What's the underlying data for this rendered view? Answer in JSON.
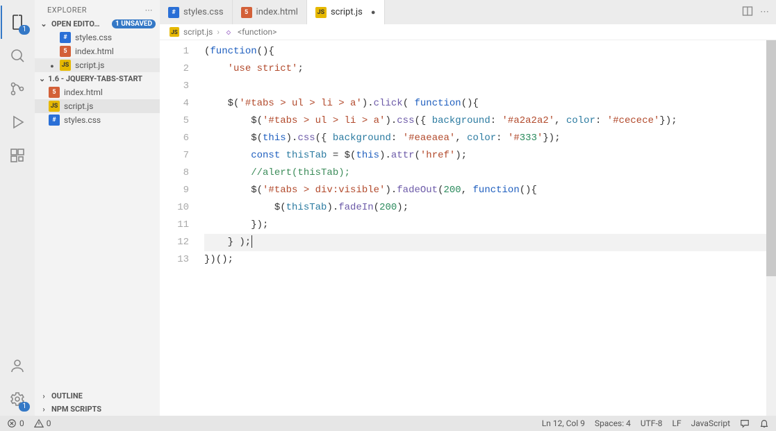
{
  "activity": {
    "explorer_badge": "1",
    "settings_badge": "1"
  },
  "sidebar": {
    "title": "EXPLORER",
    "open_editors": {
      "label": "OPEN EDITO…",
      "unsaved": "1 UNSAVED",
      "items": [
        {
          "name": "styles.css",
          "type": "css",
          "dirty": false
        },
        {
          "name": "index.html",
          "type": "html",
          "dirty": false
        },
        {
          "name": "script.js",
          "type": "js",
          "dirty": true
        }
      ]
    },
    "folder": {
      "label": "1.6 - JQUERY-TABS-START",
      "items": [
        {
          "name": "index.html",
          "type": "html"
        },
        {
          "name": "script.js",
          "type": "js",
          "active": true
        },
        {
          "name": "styles.css",
          "type": "css"
        }
      ]
    },
    "outline": "OUTLINE",
    "npm": "NPM SCRIPTS"
  },
  "tabs": [
    {
      "name": "styles.css",
      "type": "css",
      "active": false,
      "dirty": false
    },
    {
      "name": "index.html",
      "type": "html",
      "active": false,
      "dirty": false
    },
    {
      "name": "script.js",
      "type": "js",
      "active": true,
      "dirty": true
    }
  ],
  "breadcrumb": {
    "file": "script.js",
    "symbol": "<function>"
  },
  "code": {
    "lines": [
      "(function(){",
      "    'use strict';",
      "",
      "    $('#tabs > ul > li > a').click( function(){",
      "        $('#tabs > ul > li > a').css({ background: '#a2a2a2', color: '#cecece'});",
      "        $(this).css({ background: '#eaeaea', color: '#333'});",
      "        const thisTab = $(this).attr('href');",
      "        //alert(thisTab);",
      "        $('#tabs > div:visible').fadeOut(200, function(){",
      "            $(thisTab).fadeIn(200);",
      "        });",
      "    } );",
      "})();"
    ],
    "cursor_line": 12
  },
  "status": {
    "errors": "0",
    "warnings": "0",
    "position": "Ln 12, Col 9",
    "spaces": "Spaces: 4",
    "encoding": "UTF-8",
    "eol": "LF",
    "language": "JavaScript"
  }
}
